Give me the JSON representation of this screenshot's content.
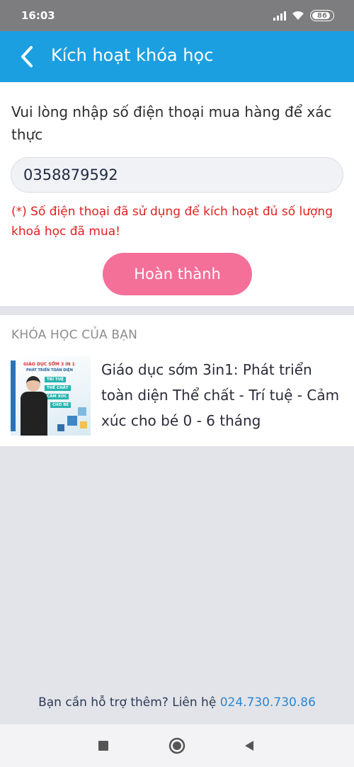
{
  "status_bar": {
    "time": "16:03",
    "battery": "86",
    "icons": [
      "signal-icon",
      "wifi-icon",
      "battery-icon"
    ]
  },
  "header": {
    "title": "Kích hoạt khóa học",
    "back_icon": "chevron-left-icon"
  },
  "form": {
    "instruction": "Vui lòng nhập số điện thoại mua hàng để xác thực",
    "phone_value": "0358879592",
    "error": "(*) Số điện thoại đã sử dụng để kích hoạt đủ số lượng khoá học đã mua!",
    "submit_label": "Hoàn thành"
  },
  "courses": {
    "heading": "KHÓA HỌC CỦA BẠN",
    "items": [
      {
        "title": "Giáo dục sớm 3in1: Phát triển toàn diện Thể chất - Trí tuệ - Cảm xúc cho bé 0 - 6 tháng",
        "thumbnail": {
          "title": "GIÁO DỤC SỚM 3 IN 1",
          "subtitle": "PHÁT TRIỂN TOÀN DIỆN",
          "tags": [
            "TRÍ TUỆ",
            "THỂ CHẤT",
            "CẢM XÚC",
            "CHO BÉ"
          ]
        }
      }
    ]
  },
  "support": {
    "text": "Bạn cần hỗ trợ thêm? Liên hệ",
    "phone": "024.730.730.86"
  },
  "nav": {
    "icons": [
      "recents-square-icon",
      "home-circle-icon",
      "back-triangle-icon"
    ]
  },
  "colors": {
    "status_bar": "#7d7d7f",
    "app_bar": "#1c9fe1",
    "error": "#e02020",
    "button": "#f47098",
    "link": "#2b86d4",
    "background": "#e3e4e9"
  }
}
